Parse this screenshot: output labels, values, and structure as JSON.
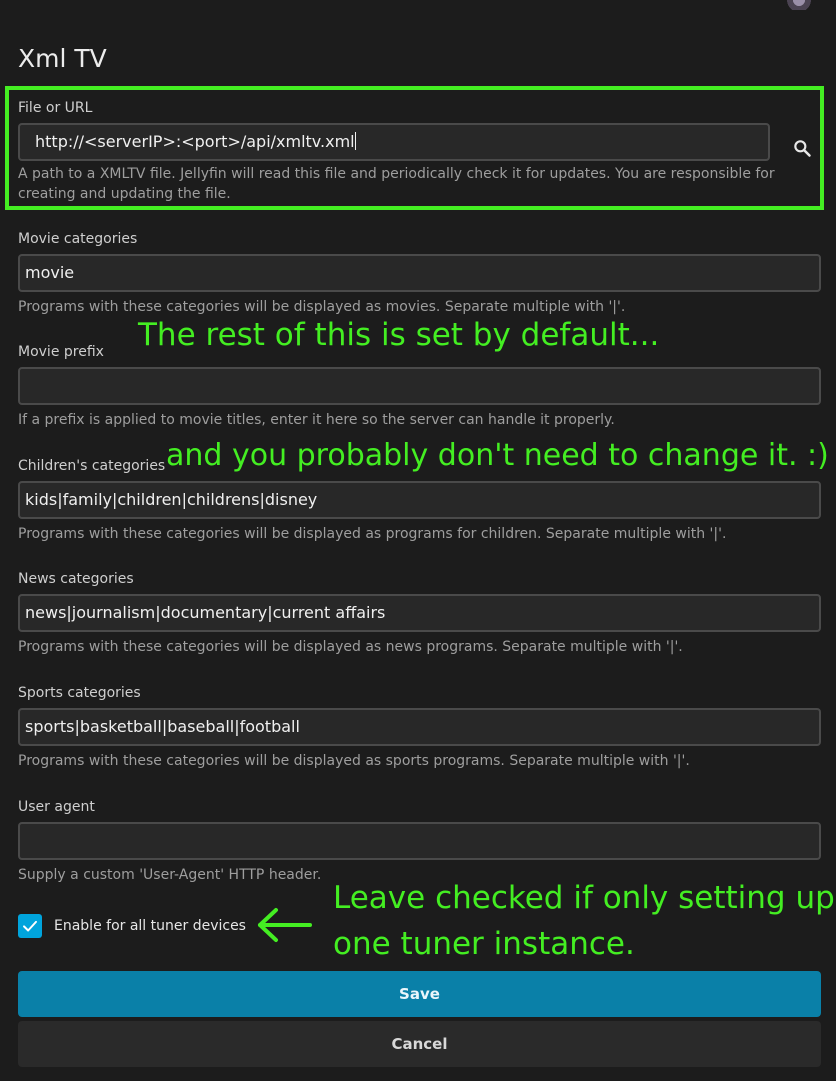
{
  "page": {
    "title": "Xml TV"
  },
  "fields": {
    "file_or_url": {
      "label": "File or URL",
      "value": "http://<serverIP>:<port>/api/xmltv.xml",
      "help": "A path to a XMLTV file. Jellyfin will read this file and periodically check it for updates. You are responsible for creating and updating the file."
    },
    "movie_categories": {
      "label": "Movie categories",
      "value": "movie",
      "help": "Programs with these categories will be displayed as movies. Separate multiple with '|'."
    },
    "movie_prefix": {
      "label": "Movie prefix",
      "value": "",
      "help": "If a prefix is applied to movie titles, enter it here so the server can handle it properly."
    },
    "children_categories": {
      "label": "Children's categories",
      "value": "kids|family|children|childrens|disney",
      "help": "Programs with these categories will be displayed as programs for children. Separate multiple with '|'."
    },
    "news_categories": {
      "label": "News categories",
      "value": "news|journalism|documentary|current affairs",
      "help": "Programs with these categories will be displayed as news programs. Separate multiple with '|'."
    },
    "sports_categories": {
      "label": "Sports categories",
      "value": "sports|basketball|baseball|football",
      "help": "Programs with these categories will be displayed as sports programs. Separate multiple with '|'."
    },
    "user_agent": {
      "label": "User agent",
      "value": "",
      "help": "Supply a custom 'User-Agent' HTTP header."
    }
  },
  "enable_all_tuners": {
    "label": "Enable for all tuner devices",
    "checked": true
  },
  "buttons": {
    "save": "Save",
    "cancel": "Cancel"
  },
  "annotations": {
    "default_note_1": "The rest of this is set by default...",
    "default_note_2": "and you probably don't need to change it. :)",
    "tuner_note_1": "Leave checked if only setting up",
    "tuner_note_2": "one tuner instance."
  },
  "colors": {
    "background": "#1c1c1c",
    "annotation": "#44ee22",
    "accent": "#00a4dc",
    "save_button": "#0a80a8"
  },
  "icons": {
    "search": "search-icon",
    "check": "check-icon",
    "arrow": "arrow-left-icon"
  }
}
